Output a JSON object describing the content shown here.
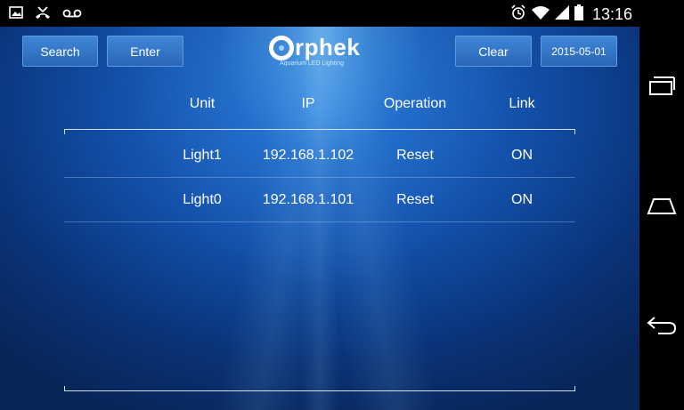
{
  "status_bar": {
    "time": "13:16",
    "left_icons": [
      "image-icon",
      "missed-call-icon",
      "voicemail-icon"
    ],
    "right_icons": [
      "alarm-icon",
      "wifi-icon",
      "signal-icon",
      "battery-icon"
    ]
  },
  "toolbar": {
    "search_label": "Search",
    "enter_label": "Enter",
    "clear_label": "Clear",
    "date": "2015-05-01"
  },
  "logo": {
    "name_rest": "rphek",
    "tagline": "Aquarium LED Lighting"
  },
  "table": {
    "headers": [
      "Unit",
      "IP",
      "Operation",
      "Link"
    ],
    "rows": [
      {
        "unit": "Light1",
        "ip": "192.168.1.102",
        "operation": "Reset",
        "link": "ON"
      },
      {
        "unit": "Light0",
        "ip": "192.168.1.101",
        "operation": "Reset",
        "link": "ON"
      }
    ]
  },
  "nav_bar": {
    "icons": [
      "recent-apps-icon",
      "home-icon",
      "back-icon"
    ]
  },
  "colors": {
    "background_top": "#1f6fd0",
    "background_bottom": "#082558",
    "button": "#2f72c4",
    "text": "#ffffff"
  }
}
